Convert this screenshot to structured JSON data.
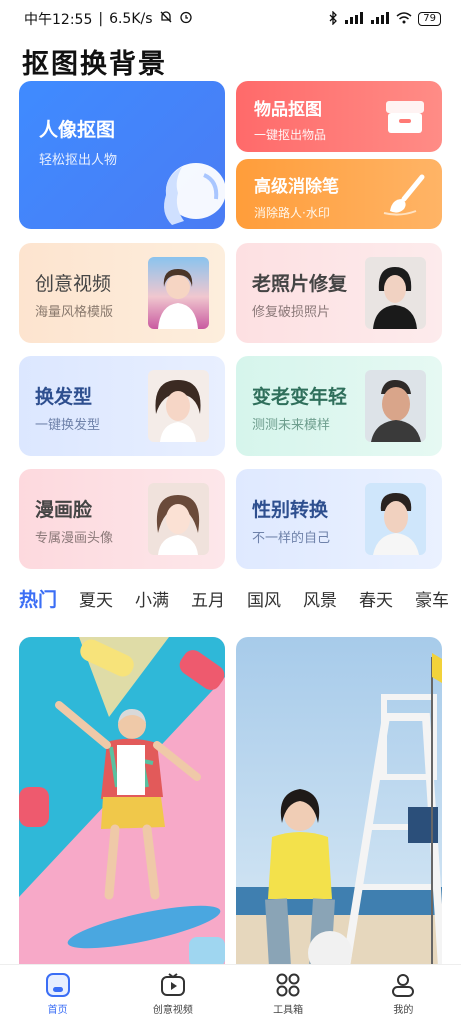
{
  "status_bar": {
    "time": "中午12:55",
    "speed": "6.5K/s",
    "battery": "79"
  },
  "app_title": "抠图换背景",
  "top_cards": {
    "portrait": {
      "title": "人像抠图",
      "subtitle": "轻松抠出人物"
    },
    "object": {
      "title": "物品抠图",
      "subtitle": "一键抠出物品"
    },
    "eraser": {
      "title": "高级消除笔",
      "subtitle": "消除路人·水印"
    }
  },
  "tiles": [
    {
      "title": "创意视频",
      "subtitle": "海量风格模版",
      "bg": "#fde9da",
      "title_color": "#444444"
    },
    {
      "title": "老照片修复",
      "subtitle": "修复破损照片",
      "bg": "#fde3e5",
      "title_color": "#444444"
    },
    {
      "title": "换发型",
      "subtitle": "一键换发型",
      "bg": "#e3ebff",
      "title_color": "#2e4f8f"
    },
    {
      "title": "变老变年轻",
      "subtitle": "测测未来模样",
      "bg": "#dcf6ee",
      "title_color": "#2f6f5b"
    },
    {
      "title": "漫画脸",
      "subtitle": "专属漫画头像",
      "bg": "#fde1e4",
      "title_color": "#444444"
    },
    {
      "title": "性别转换",
      "subtitle": "不一样的自己",
      "bg": "#e2ecff",
      "title_color": "#2e4f8f"
    }
  ],
  "category_tabs": [
    "热门",
    "夏天",
    "小满",
    "五月",
    "国风",
    "风景",
    "春天",
    "豪车"
  ],
  "bottom_nav": [
    {
      "label": "首页",
      "icon": "home-icon"
    },
    {
      "label": "创意视频",
      "icon": "video-icon"
    },
    {
      "label": "工具箱",
      "icon": "toolbox-icon"
    },
    {
      "label": "我的",
      "icon": "profile-icon"
    }
  ]
}
